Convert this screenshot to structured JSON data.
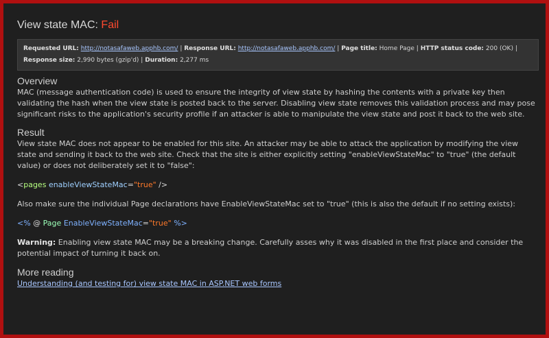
{
  "header": {
    "title_prefix": "View state MAC:",
    "status": "Fail"
  },
  "info": {
    "requested_url_label": "Requested URL:",
    "requested_url": "http://notasafaweb.apphb.com/",
    "response_url_label": "Response URL:",
    "response_url": "http://notasafaweb.apphb.com/",
    "page_title_label": "Page title:",
    "page_title": "Home Page",
    "http_status_label": "HTTP status code:",
    "http_status": "200 (OK)",
    "response_size_label": "Response size:",
    "response_size": "2,990 bytes (gzip'd)",
    "duration_label": "Duration:",
    "duration": "2,277 ms",
    "separator": "|"
  },
  "overview": {
    "heading": "Overview",
    "text": "MAC (message authentication code) is used to ensure the integrity of view state by hashing the contents with a private key then validating the hash when the view state is posted back to the server. Disabling view state removes this validation process and may pose significant risks to the application's security profile if an attacker is able to manipulate the view state and post it back to the web site."
  },
  "result": {
    "heading": "Result",
    "text": "View state MAC does not appear to be enabled for this site. An attacker may be able to attack the application by modifying the view state and sending it back to the web site. Check that the site is either explicitly setting \"enableViewStateMac\" to \"true\" (the default value) or does not deliberately set it to \"false\":",
    "code1": {
      "open": "<",
      "tag": "pages",
      "attr": "enableViewStateMac",
      "eq": "=",
      "value": "\"true\"",
      "close": " />"
    },
    "text2": "Also make sure the individual Page declarations have EnableViewStateMac set to \"true\" (this is also the default if no setting exists):",
    "code2": {
      "open": "<%",
      "at": " @ ",
      "directive": "Page",
      "attr": "EnableViewStateMac",
      "eq": "=",
      "value": "\"true\"",
      "close": " %>"
    },
    "warning_label": "Warning:",
    "warning_text": " Enabling view state MAC may be a breaking change. Carefully asses why it was disabled in the first place and consider the potential impact of turning it back on."
  },
  "more_reading": {
    "heading": "More reading",
    "link_text": "Understanding (and testing for) view state MAC in ASP.NET web forms"
  }
}
